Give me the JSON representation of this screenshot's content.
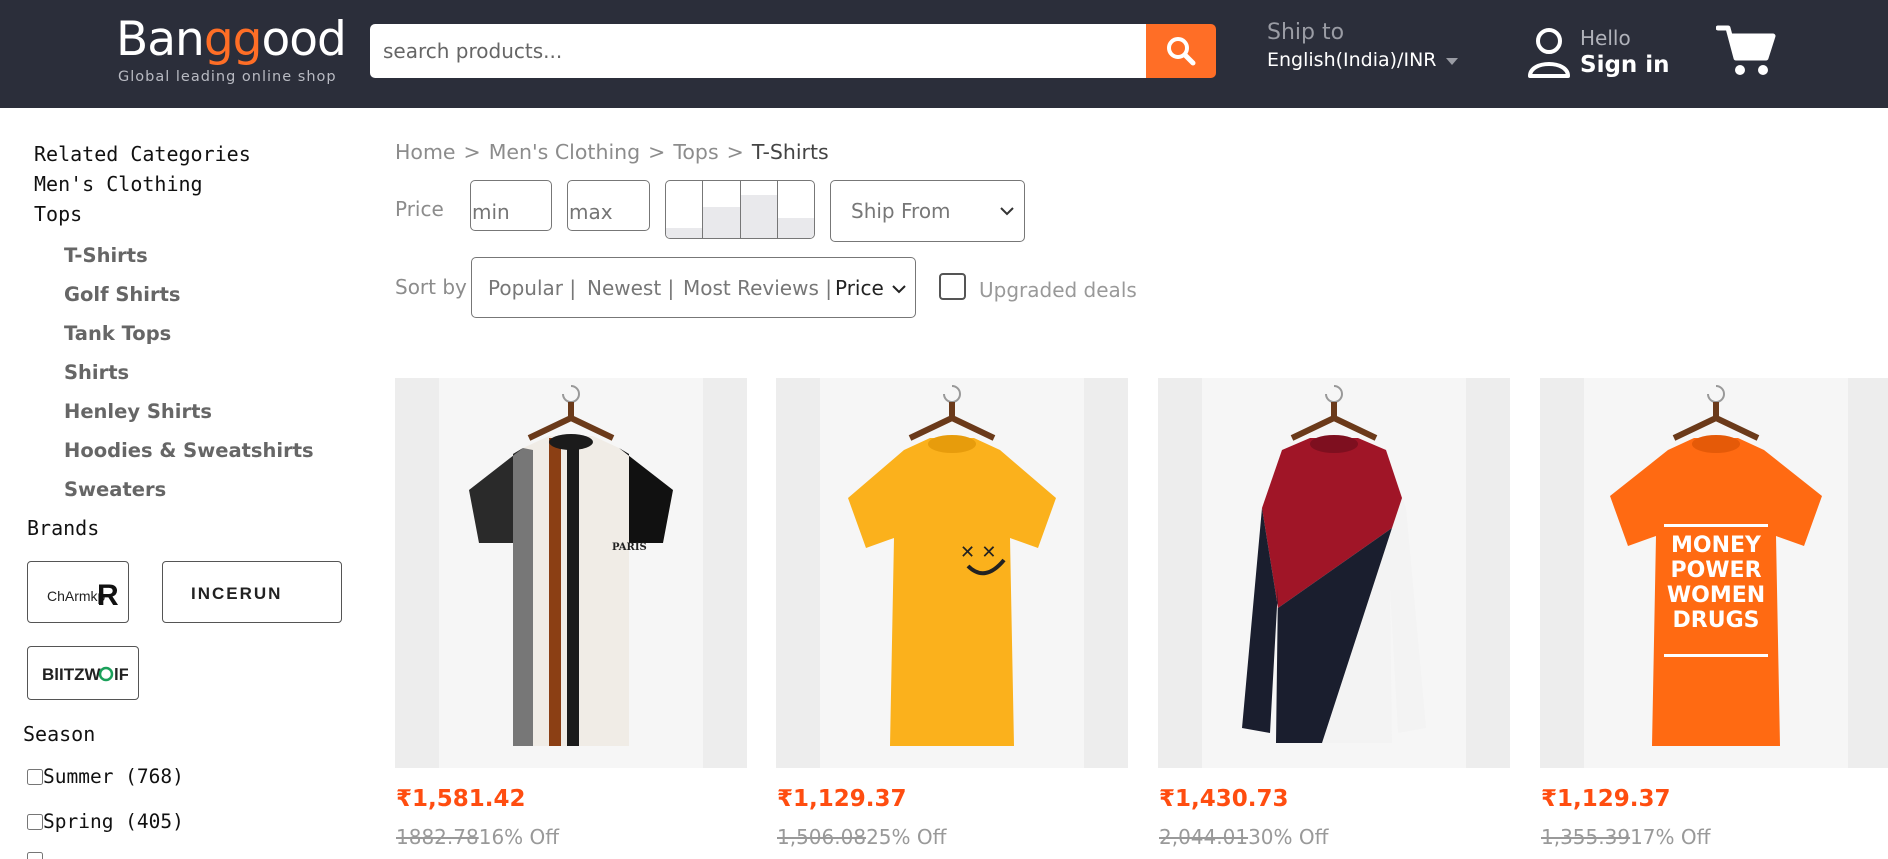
{
  "header": {
    "logo_pre": "Ban",
    "logo_mid": "gg",
    "logo_post": "ood",
    "logo_tagline": "Global leading online shop",
    "search_placeholder": "search products...",
    "ship_to_label": "Ship to",
    "ship_to_value": "English(India)/INR",
    "hello": "Hello",
    "sign_in": "Sign in"
  },
  "sidebar": {
    "related_title": "Related Categories",
    "level1": "Men's Clothing",
    "level2": "Tops",
    "subcategories": [
      "T-Shirts",
      "Golf Shirts",
      "Tank Tops",
      "Shirts",
      "Henley Shirts",
      "Hoodies & Sweatshirts",
      "Sweaters"
    ],
    "brands_title": "Brands",
    "brands": [
      "ChArmkpR",
      "INCERUN",
      "BlitzWolf"
    ],
    "season_title": "Season",
    "seasons": [
      {
        "label": "Summer (768)"
      },
      {
        "label": "Spring (405)"
      }
    ]
  },
  "breadcrumb": [
    "Home",
    "Men's Clothing",
    "Tops",
    "T-Shirts"
  ],
  "filters": {
    "price_label": "Price",
    "min_placeholder": "min",
    "max_placeholder": "max",
    "histogram_levels": [
      0.18,
      0.55,
      0.75,
      0.35
    ],
    "ship_from": "Ship From",
    "sort_label": "Sort by",
    "sort_options": [
      "Popular |",
      "Newest |",
      "Most Reviews |"
    ],
    "sort_price": "Price",
    "upgraded_deals": "Upgraded deals"
  },
  "products": [
    {
      "price": "₹1,581.42",
      "old_price": "1882.78",
      "discount": "16% Off",
      "shirt_text": "PARIS",
      "image_icon": "striped-tshirt"
    },
    {
      "price": "₹1,129.37",
      "old_price": "1,506.08",
      "discount": "25% Off",
      "shirt_text": "",
      "image_icon": "yellow-smiley-tshirt"
    },
    {
      "price": "₹1,430.73",
      "old_price": "2,044.01",
      "discount": "30% Off",
      "shirt_text": "",
      "image_icon": "colorblock-longsleeve"
    },
    {
      "price": "₹1,129.37",
      "old_price": "1,355.39",
      "discount": "17% Off",
      "shirt_text": "MONEY POWER WOMEN DRUGS",
      "image_icon": "orange-slogan-tshirt"
    }
  ],
  "colors": {
    "header_bg": "#2b2e3a",
    "accent": "#ff6e26",
    "price": "#ff4d10"
  }
}
